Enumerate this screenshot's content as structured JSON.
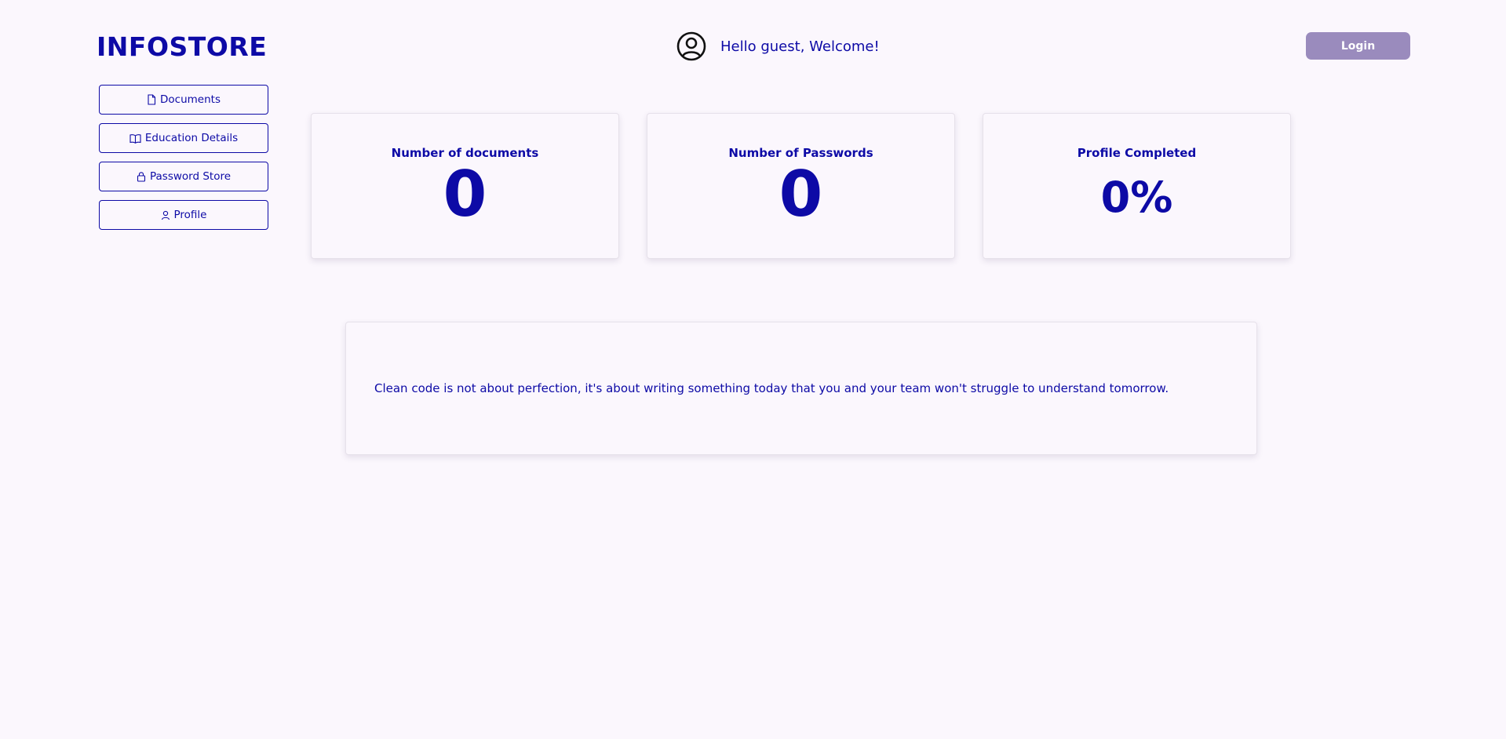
{
  "header": {
    "brand": "INFOSTORE",
    "greeting": "Hello guest, Welcome!",
    "avatar_icon": "user-circle-icon",
    "login_label": "Login"
  },
  "sidebar": {
    "items": [
      {
        "label": "Documents",
        "icon": "file-icon"
      },
      {
        "label": "Education Details",
        "icon": "book-icon"
      },
      {
        "label": "Password Store",
        "icon": "lock-icon"
      },
      {
        "label": "Profile",
        "icon": "user-icon"
      }
    ]
  },
  "stats": [
    {
      "label": "Number of documents",
      "value": "0"
    },
    {
      "label": "Number of Passwords",
      "value": "0"
    },
    {
      "label": "Profile Completed",
      "value": "0%"
    }
  ],
  "quote": {
    "text": "Clean code is not about perfection, it's about writing something today that you and your team won't struggle to understand tomorrow."
  },
  "colors": {
    "accent": "#0d0aa6",
    "login_button": "#9a8bbd",
    "background": "#fbf7fd"
  }
}
